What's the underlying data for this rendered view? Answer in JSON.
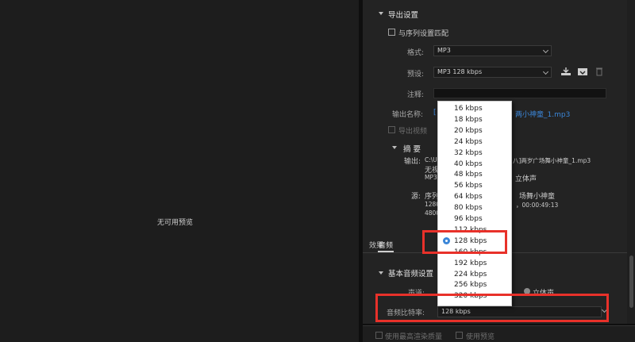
{
  "preview": {
    "no_preview": "无可用预览"
  },
  "export_settings": {
    "title": "导出设置",
    "match_sequence": "与序列设置匹配",
    "format_label": "格式:",
    "format_value": "MP3",
    "preset_label": "预设:",
    "preset_value": "MP3 128 kbps",
    "comment_label": "注释:",
    "output_name_label": "输出名称:",
    "output_name_prefix": "[",
    "output_name_value": "两小神童_1.mp3",
    "export_video": "导出视频",
    "summary": {
      "title": "摘 要",
      "output_label": "输出:",
      "output_line1_left": "C:\\U",
      "output_line1_right": "八]两岁广场舞小神童_1.mp3",
      "output_line2": "无视",
      "output_line3_left": "MP3",
      "output_line3_right": "立体声",
      "source_label": "源:",
      "source_line1_left": "序列",
      "source_line1_right": "场舞小神童",
      "source_line2_left": "1280",
      "source_line2_right": "，00:00:49:13",
      "source_line3": "4800"
    }
  },
  "tabs": {
    "effects": "效果",
    "audio": "音频"
  },
  "basic_audio": {
    "title": "基本音频设置",
    "channels_label": "声道:",
    "stereo": "立体声",
    "bitrate_label": "音频比特率:",
    "bitrate_value": "128 kbps"
  },
  "bottom": {
    "max_render": "使用最高渲染质量",
    "use_preview": "使用预览"
  },
  "bitrate_options": [
    "16 kbps",
    "18 kbps",
    "20 kbps",
    "24 kbps",
    "32 kbps",
    "40 kbps",
    "48 kbps",
    "56 kbps",
    "64 kbps",
    "80 kbps",
    "96 kbps",
    "112 kbps",
    "128 kbps",
    "160 kbps",
    "192 kbps",
    "224 kbps",
    "256 kbps",
    "320 kbps"
  ],
  "selected_bitrate_index": 12,
  "colors": {
    "accent": "#3b86d8",
    "highlight": "#e8312a",
    "panel": "#232323"
  },
  "icons": [
    "chevron-down-icon",
    "save-preset-icon",
    "import-preset-icon",
    "trash-icon",
    "checkbox-icon",
    "radio-icon"
  ]
}
